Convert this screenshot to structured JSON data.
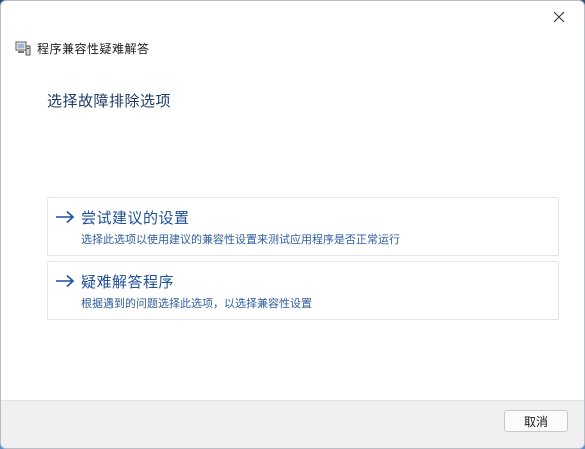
{
  "window": {
    "app_title": "程序兼容性疑难解答",
    "app_icon": "troubleshooter-computer-icon",
    "close_icon": "close-icon"
  },
  "main": {
    "page_title": "选择故障排除选项",
    "options": [
      {
        "title": "尝试建议的设置",
        "description": "选择此选项以使用建议的兼容性设置来测试应用程序是否正常运行",
        "icon": "arrow-right-icon"
      },
      {
        "title": "疑难解答程序",
        "description": "根据遇到的问题选择此选项，以选择兼容性设置",
        "icon": "arrow-right-icon"
      }
    ]
  },
  "footer": {
    "cancel_label": "取消"
  },
  "colors": {
    "link_blue": "#1e4f9a",
    "title_blue": "#1e3a66",
    "footer_bg": "#f0f0f0"
  }
}
